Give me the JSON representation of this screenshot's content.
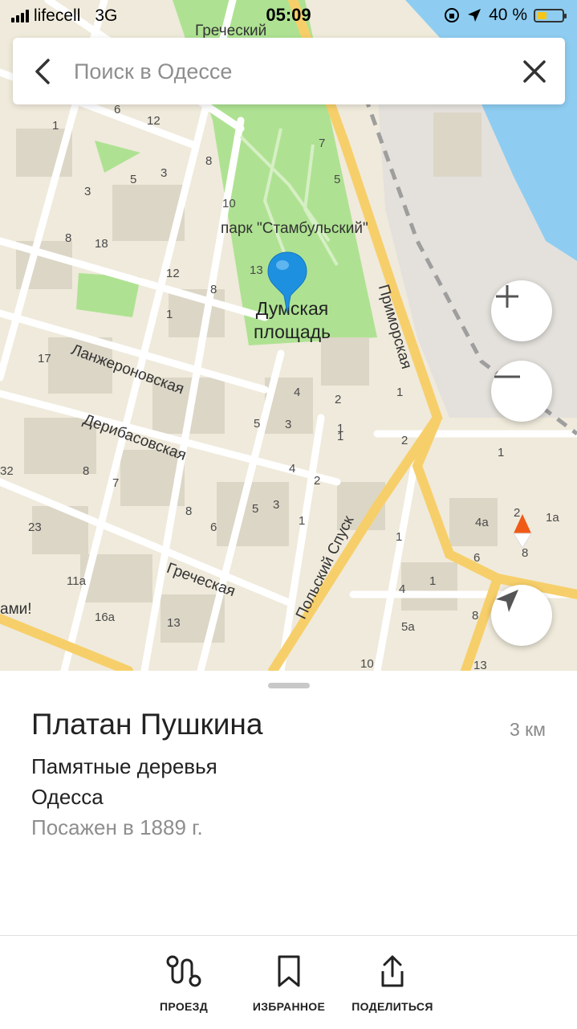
{
  "status_bar": {
    "carrier": "lifecell",
    "network": "3G",
    "time": "05:09",
    "battery": "40 %",
    "battery_level": 0.4,
    "icons": [
      "signal-icon",
      "orientation-lock-icon",
      "location-arrow-icon",
      "battery-icon"
    ]
  },
  "search": {
    "placeholder": "Поиск в Одессе",
    "back_icon": "chevron-left-icon",
    "clear_icon": "close-icon"
  },
  "map": {
    "labels": {
      "park": "парк \"Стамбульский\"",
      "square_line1": "Думская",
      "square_line2": "площадь",
      "street_langeron": "Ланжероновская",
      "street_deribas": "Дерибасовская",
      "street_greek": "Греческая",
      "street_primorskaya": "Приморская",
      "street_polsky": "Польский Спуск",
      "top_greek": "Греческий",
      "edge_text": "ами!"
    },
    "house_numbers": [
      "1",
      "12",
      "6",
      "3",
      "8",
      "5",
      "3",
      "8",
      "10",
      "7",
      "5",
      "18",
      "12",
      "8",
      "13",
      "1",
      "17",
      "4",
      "2",
      "5",
      "3",
      "4",
      "2",
      "1",
      "2",
      "5",
      "3",
      "8",
      "7",
      "1",
      "8",
      "6",
      "23",
      "32",
      "11а",
      "16а",
      "13",
      "4",
      "1",
      "1",
      "5а",
      "1",
      "8",
      "10",
      "13",
      "4а",
      "6",
      "1а",
      "2",
      "8",
      "2",
      "1",
      "1",
      "1",
      "3",
      "5",
      "6",
      "7"
    ],
    "controls": {
      "zoom_in_icon": "plus-icon",
      "zoom_out_icon": "minus-icon",
      "compass_icon": "compass-icon",
      "locate_icon": "navigation-arrow-icon"
    },
    "colors": {
      "land": "#efeadb",
      "park": "#aee292",
      "water": "#8ecdf1",
      "road_major": "#f7cf6a",
      "pin": "#1e90e0"
    }
  },
  "place": {
    "title": "Платан Пушкина",
    "distance": "3 км",
    "category": "Памятные деревья",
    "city": "Одесса",
    "description": "Посажен в 1889 г."
  },
  "actions": [
    {
      "label": "ПРОЕЗД",
      "icon": "route-icon"
    },
    {
      "label": "ИЗБРАННОЕ",
      "icon": "bookmark-icon"
    },
    {
      "label": "ПОДЕЛИТЬСЯ",
      "icon": "share-icon"
    }
  ]
}
